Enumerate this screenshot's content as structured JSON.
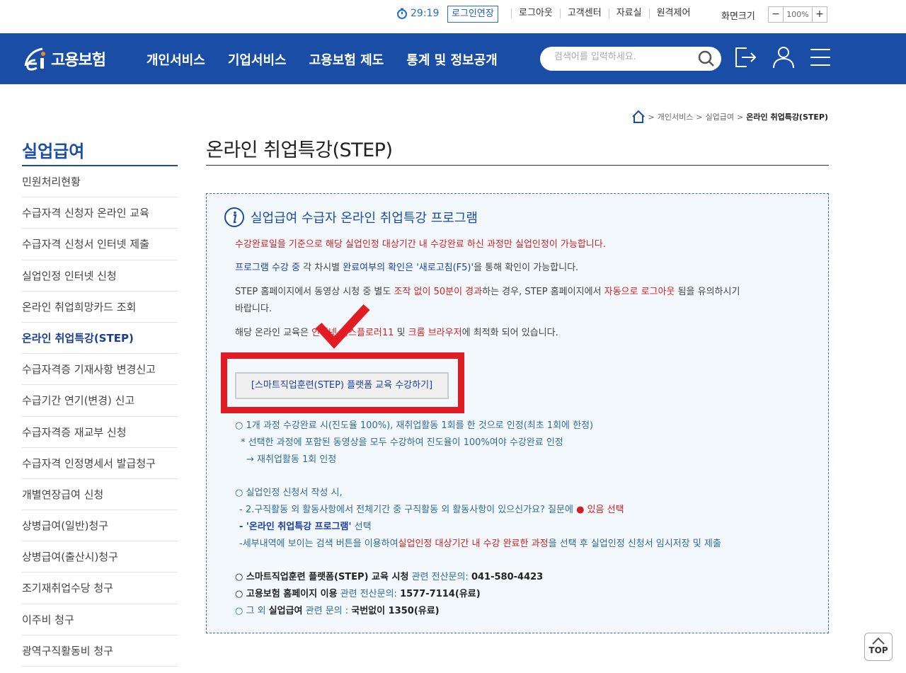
{
  "util": {
    "timer": "29:19",
    "extend_label": "로그인연장",
    "links": [
      "로그아웃",
      "고객센터",
      "자료실",
      "원격제어"
    ],
    "zoom_label": "화면크기",
    "zoom_minus": "−",
    "zoom_value": "100%",
    "zoom_plus": "+"
  },
  "nav": {
    "logo_text": "고용보험",
    "items": [
      "개인서비스",
      "기업서비스",
      "고용보험 제도",
      "통계 및 정보공개"
    ],
    "search_placeholder": "검색어를 입력하세요."
  },
  "breadcrumb": {
    "items": [
      "개인서비스",
      "실업급여"
    ],
    "current": "온라인 취업특강(STEP)"
  },
  "sidebar": {
    "title": "실업급여",
    "items": [
      "민원처리현황",
      "수급자격 신청자 온라인 교육",
      "수급자격 신청서 인터넷 제출",
      "실업인정 인터넷 신청",
      "온라인 취업희망카드 조회",
      "온라인 취업특강(STEP)",
      "수급자격증 기재사항 변경신고",
      "수급기간 연기(변경) 신고",
      "수급자격증 재교부 신청",
      "수급자격 인정명세서 발급청구",
      "개별연장급여 신청",
      "상병급여(일반)청구",
      "상병급여(출산시)청구",
      "조기재취업수당 청구",
      "이주비 청구",
      "광역구직활동비 청구"
    ],
    "active_index": 5
  },
  "content": {
    "title": "온라인 취업특강(STEP)",
    "box_title": "실업급여 수급자 온라인 취업특강 프로그램",
    "notice1": "수강완료일을 기준으로 해당 실업인정 대상기간 내 수강완료 하신 과정만 실업인정이 가능합니다.",
    "notice2_a": "프로그램 수강 중",
    "notice2_b": " 각 차시별 ",
    "notice2_c": "완료여부의 확인은 '새로고침(F5)'",
    "notice2_d": "을 통해 확인이 가능합니다.",
    "notice3_a": "STEP 홈페이지에서 동영상 시청 중 별도 ",
    "notice3_b": "조작 없이 50분이 경과",
    "notice3_c": "하는 경우, STEP 홈페이지에서 ",
    "notice3_d": "자동으로 로그아웃",
    "notice3_e": " 됨을 유의하시기",
    "notice3_f": "바랍니다.",
    "notice4_a": "해당 온라인 교육은 ",
    "notice4_b": "인터넷 익스플로러11",
    "notice4_c": " 및 ",
    "notice4_d": "크롬 브라우저",
    "notice4_e": "에 최적화 되어 있습니다.",
    "step_button": "[스마트직업훈련(STEP) 플랫폼 교육 수강하기]",
    "b1_line1": "○ 1개 과정 수강완료 시(진도율 100%), 재취업활동 1회를 한 것으로 인정(최초 1회에 한정)",
    "b1_line2": "* 선택한 과정에 포함된 동영상을 모두 수강하여 진도율이 100%여야 수강완료 인정",
    "b1_line3": "→ 재취업활동 1회 인정",
    "b2_line1": "○ 실업인정 신청서 작성 시,",
    "b2_line2_a": "- 2.구직활동 외 활동사항에서 전체기간 중 구직활동 외 활동사항이 있으신가요? 질문에 ",
    "b2_line2_b": " 있음 선택",
    "b2_line3_a": "- '온라인 취업특강 프로그램'",
    "b2_line3_b": " 선택",
    "b2_line4_a": "-세부내역에 보이는 검색 버튼을 이용하여",
    "b2_line4_b": "실업인정 대상기간 내 수강 완료한 과정",
    "b2_line4_c": "을 선택 후 실업인정 신청서 임시저장 및 제출",
    "c1_a": "○ ",
    "c1_b": "스마트직업훈련 플랫폼(STEP) 교육 시청",
    "c1_c": " 관련 전산문의: ",
    "c1_d": "041-580-4423",
    "c2_b": "고용보험 홈페이지 이용",
    "c2_c": " 관련 전산문의: ",
    "c2_d": "1577-7114(유료)",
    "c3_a": "○ 그 외 ",
    "c3_b": "실업급여",
    "c3_c": " 관련 문의 : ",
    "c3_d": "국번없이 1350(유료)"
  },
  "top_button": "TOP",
  "colors": {
    "nav_bg": "#1a4ea6",
    "highlight_frame": "#e21c23",
    "alert_red": "#d42020",
    "box_bg": "#f3f8fd"
  }
}
